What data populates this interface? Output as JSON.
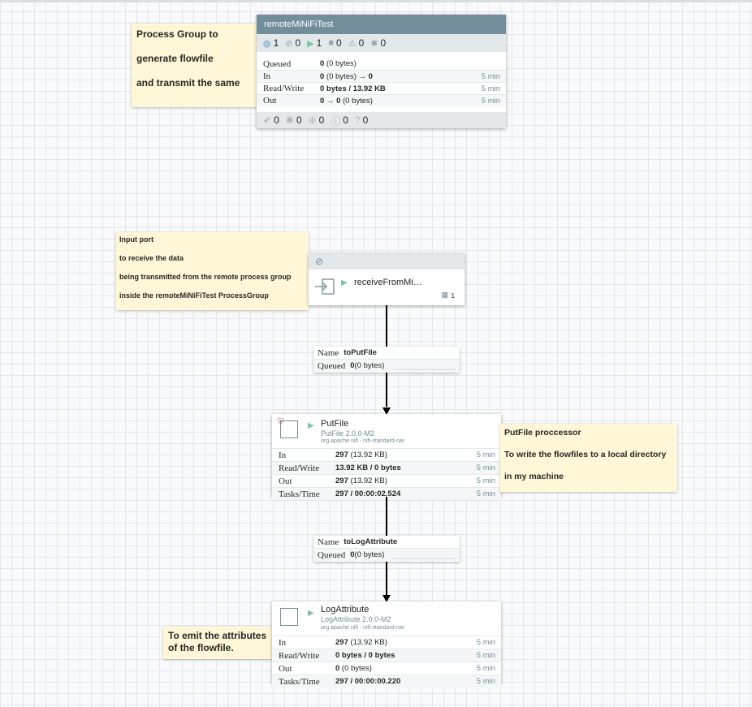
{
  "notes": {
    "pg_note": [
      "Process Group to",
      "generate flowfile",
      "and transmit the same"
    ],
    "port_note": [
      "Input port",
      "to receive the data",
      "being transmitted from the remote process group",
      "inside the remoteMiNiFiTest ProcessGroup"
    ],
    "putfile_note": [
      "PutFile proccessor",
      "To write the flowfiles to a local directory",
      "in my machine"
    ],
    "log_note": [
      "To emit the attributes",
      "of the flowfile."
    ]
  },
  "process_group": {
    "name": "remoteMiNiFiTest",
    "status": {
      "transmitting": "1",
      "not_transmitting": "0",
      "running": "1",
      "stopped": "0",
      "invalid": "0",
      "disabled": "0"
    },
    "stats": {
      "queued": {
        "label": "Queued",
        "bold": "0",
        "rest": " (0 bytes)"
      },
      "in": {
        "label": "In",
        "bold": "0",
        "rest": " (0 bytes) ",
        "arrow": "→",
        "bold2": " 0",
        "time": "5 min"
      },
      "rw": {
        "label": "Read/Write",
        "value": "0 bytes / 13.92 KB",
        "time": "5 min"
      },
      "out": {
        "label": "Out",
        "bold": "0",
        "arrow": " → ",
        "bold2": "0",
        "rest": " (0 bytes)",
        "time": "5 min"
      }
    },
    "footer": {
      "up_to_date": "0",
      "locally_modified": "0",
      "stale": "0",
      "locally_modified_stale": "0",
      "sync_failure": "0"
    }
  },
  "input_port": {
    "name": "receiveFromMi…",
    "remote_count": "1"
  },
  "connections": [
    {
      "name_label": "Name",
      "name": "toPutFile",
      "queued_label": "Queued",
      "queued_bold": "0",
      "queued_rest": " (0 bytes)"
    },
    {
      "name_label": "Name",
      "name": "toLogAttribute",
      "queued_label": "Queued",
      "queued_bold": "0",
      "queued_rest": " (0 bytes)"
    }
  ],
  "processors": [
    {
      "name": "PutFile",
      "type": "PutFile 2.0.0-M2",
      "bundle": "org.apache.nifi - nifi-standard-nar",
      "in": {
        "label": "In",
        "bold": "297",
        "rest": " (13.92 KB)",
        "time": "5 min"
      },
      "rw": {
        "label": "Read/Write",
        "value": "13.92 KB / 0 bytes",
        "time": "5 min"
      },
      "out": {
        "label": "Out",
        "bold": "297",
        "rest": " (13.92 KB)",
        "time": "5 min"
      },
      "tasks": {
        "label": "Tasks/Time",
        "value": "297 / 00:00:02.524",
        "time": "5 min"
      }
    },
    {
      "name": "LogAttribute",
      "type": "LogAttribute 2.0.0-M2",
      "bundle": "org.apache.nifi - nifi-standard-nar",
      "in": {
        "label": "In",
        "bold": "297",
        "rest": " (13.92 KB)",
        "time": "5 min"
      },
      "rw": {
        "label": "Read/Write",
        "value": "0 bytes / 0 bytes",
        "time": "5 min"
      },
      "out": {
        "label": "Out",
        "bold": "0",
        "rest": " (0 bytes)",
        "time": "5 min"
      },
      "tasks": {
        "label": "Tasks/Time",
        "value": "297 / 00:00:00.220",
        "time": "5 min"
      }
    }
  ],
  "colors": {
    "accent": "#728e9b",
    "note_bg": "#fff7d7",
    "running": "#7dc7a0",
    "canvas": "#f9fafb"
  }
}
